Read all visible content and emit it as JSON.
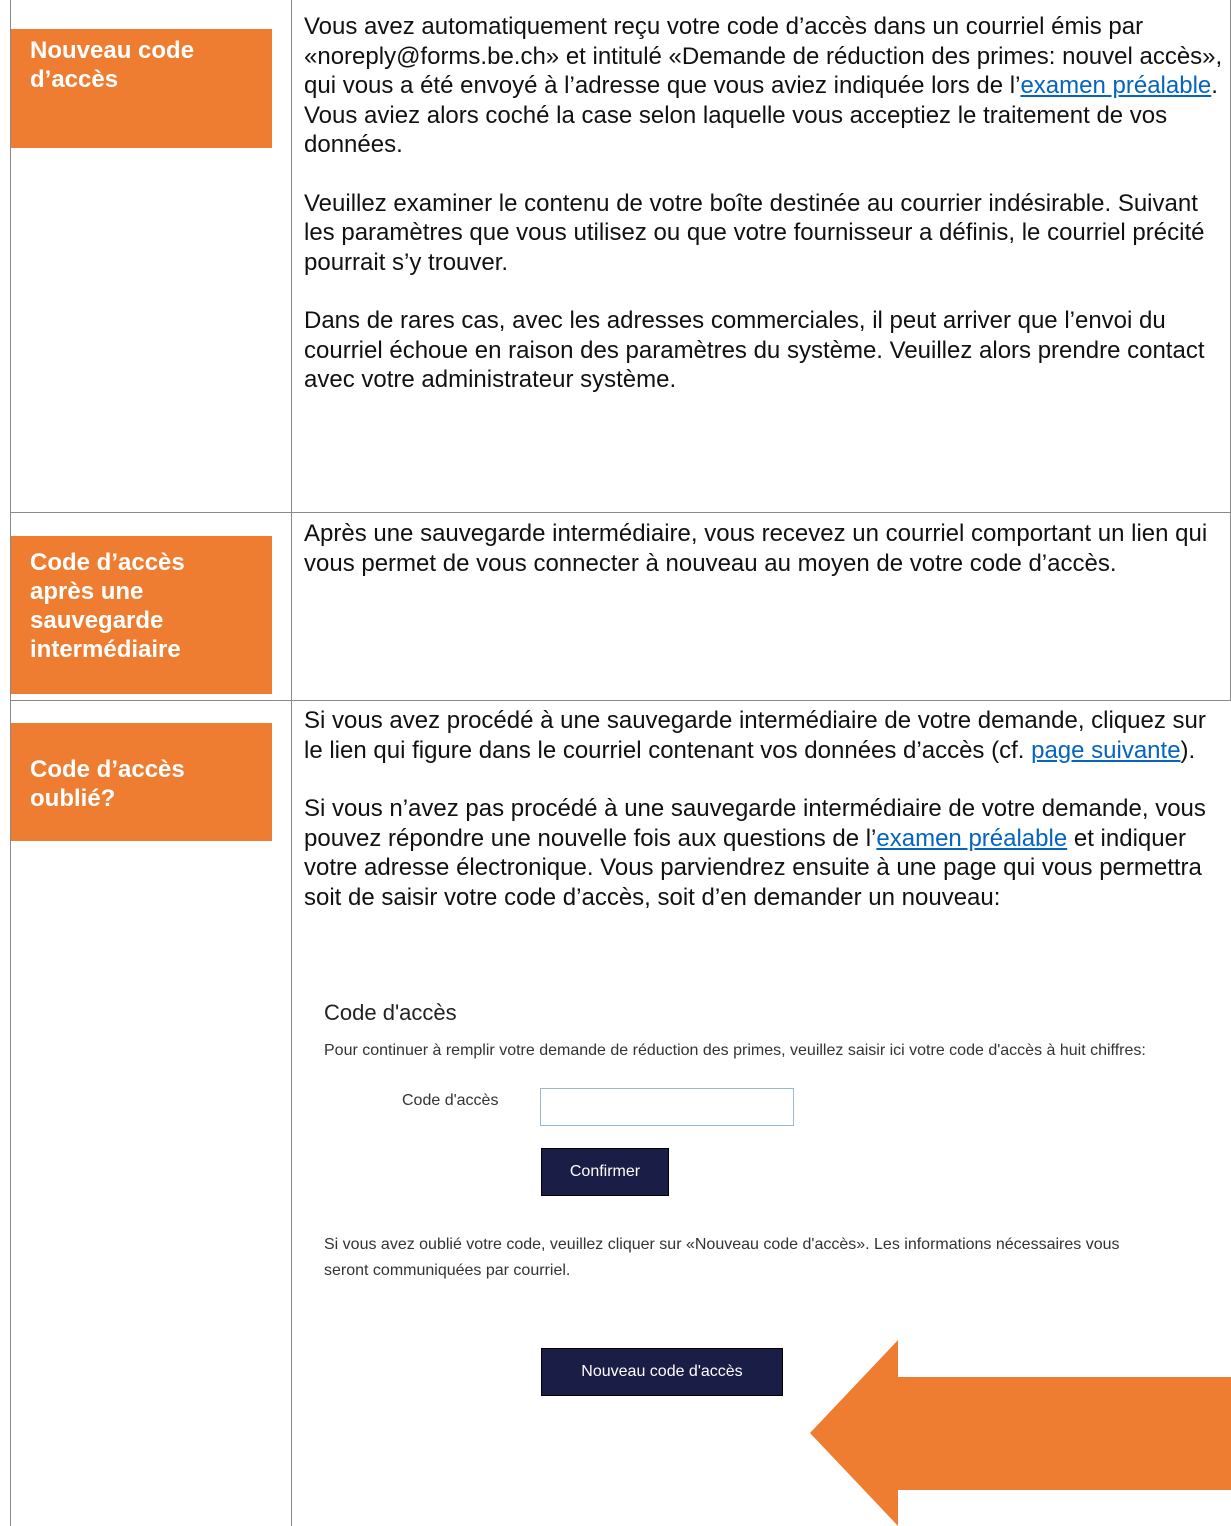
{
  "rows": [
    {
      "label": "Nouveau code d’accès",
      "paragraphs": [
        {
          "before": "Vous avez automatiquement reçu votre code d’accès dans un courriel émis par «noreply@forms.be.ch» et intitulé «Demande de réduction des primes: nouvel accès», qui vous a été envoyé à l’adresse que vous aviez indiquée lors de l’",
          "link": "examen préalable",
          "after": ". Vous aviez alors coché la case selon laquelle vous acceptiez le traitement de vos données."
        },
        {
          "text": "Veuillez examiner le contenu de votre boîte destinée au courrier indésirable. Suivant les paramètres que vous utilisez ou que votre fournisseur a définis, le courriel précité pourrait s’y trouver."
        },
        {
          "text": "Dans de rares cas, avec les adresses commerciales, il peut arriver que l’envoi du courriel échoue en raison des paramètres du système. Veuillez alors prendre contact avec votre administrateur système."
        }
      ]
    },
    {
      "label": "Code d’accès après une sauvegarde intermédiaire",
      "paragraphs": [
        {
          "text": "Après une sauvegarde intermédiaire, vous recevez un courriel comportant un lien qui vous permet de vous connecter à nouveau au moyen de votre code d’accès."
        }
      ]
    },
    {
      "label": "Code d’accès oublié?",
      "paragraphs": [
        {
          "before": "Si vous avez procédé à une sauvegarde intermédiaire de votre demande, cliquez sur le lien qui figure dans le courriel contenant vos données d’accès (cf. ",
          "link": "page suivante",
          "after": ")."
        },
        {
          "before": "Si vous n’avez pas procédé à une sauvegarde intermédiaire de votre demande, vous pouvez répondre une nouvelle fois aux questions de l’",
          "link": "examen préalable",
          "after": " et indiquer votre adresse électronique. Vous parviendrez ensuite à une page qui vous permettra soit de saisir votre code d’accès, soit d’en demander un nouveau:"
        }
      ]
    }
  ],
  "screenshot": {
    "title": "Code d'accès",
    "intro": "Pour continuer à remplir votre demande de réduction des primes, veuillez saisir ici votre code d'accès à huit chiffres:",
    "field_label": "Code d'accès",
    "field_value": "",
    "confirm_button": "Confirmer",
    "forgot_text": "Si vous avez oublié votre code, veuillez cliquer sur «Nouveau code d'accès». Les informations nécessaires vous seront communiquées par courriel.",
    "new_code_button": "Nouveau code d'accès"
  },
  "colors": {
    "label_bg": "#ee7d31",
    "link": "#0563c1",
    "button_bg": "#1a1d45",
    "arrow": "#ee7d31"
  },
  "icons": {
    "arrow": "left-pointing-arrow-icon"
  }
}
